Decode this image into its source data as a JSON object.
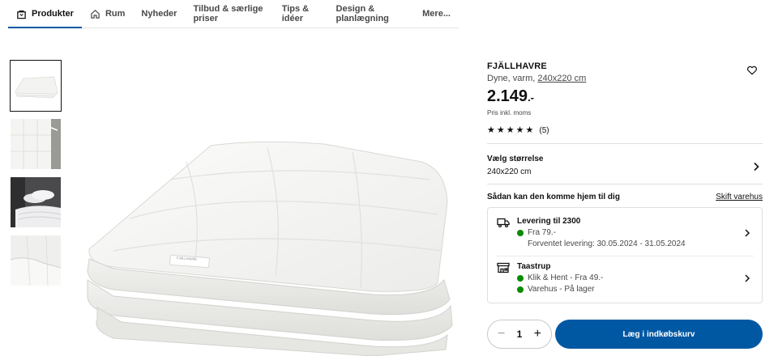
{
  "nav": {
    "items": [
      {
        "label": "Produkter",
        "icon": "bag-icon",
        "active": true
      },
      {
        "label": "Rum",
        "icon": "home-icon",
        "active": false
      },
      {
        "label": "Nyheder"
      },
      {
        "label": "Tilbud & særlige priser"
      },
      {
        "label": "Tips & idéer"
      },
      {
        "label": "Design & planlægning"
      },
      {
        "label": "Mere..."
      }
    ]
  },
  "gallery": {
    "thumbnails": [
      "duvet-folded",
      "duvet-flat-detail",
      "bed-with-pillows",
      "duvet-corner-detail"
    ],
    "main": "duvet-folded"
  },
  "product": {
    "name": "FJÄLLHAVRE",
    "desc_prefix": "Dyne, varm, ",
    "desc_size": "240x220 cm",
    "price": "2.149",
    "price_suffix": ".-",
    "vat_note": "Pris inkl. moms",
    "rating_stars": 5,
    "rating_count": "(5)",
    "tag_text": "FJÄLLHAVRE"
  },
  "size": {
    "label": "Vælg størrelse",
    "value": "240x220 cm"
  },
  "delivery": {
    "question": "Sådan kan den komme hjem til dig",
    "change_store": "Skift varehus",
    "shipping": {
      "title": "Levering til 2300",
      "price": "Fra 79.-",
      "eta": "Forventet levering: 30.05.2024 - 31.05.2024"
    },
    "store": {
      "title": "Taastrup",
      "click_collect": "Klik & Hent - Fra 49.-",
      "stock": "Varehus - På lager"
    }
  },
  "cart": {
    "quantity": "1",
    "minus": "−",
    "plus": "+",
    "add_label": "Læg i indkøbskurv"
  },
  "colors": {
    "accent": "#0058a3",
    "in_stock": "#0a8a00"
  }
}
